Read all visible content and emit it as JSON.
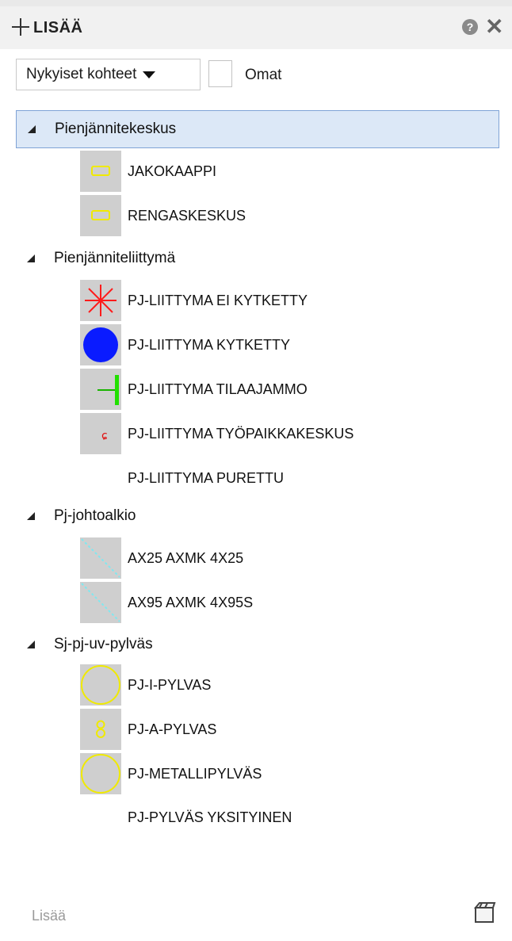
{
  "header": {
    "title": "LISÄÄ"
  },
  "filter": {
    "dropdown_value": "Nykyiset kohteet",
    "checkbox_label": "Omat"
  },
  "tree": [
    {
      "label": "Pienjännitekeskus",
      "selected": true,
      "items": [
        {
          "label": "JAKOKAAPPI",
          "icon": "yellow-rectangle-icon"
        },
        {
          "label": "RENGASKESKUS",
          "icon": "yellow-rectangle-icon"
        }
      ]
    },
    {
      "label": "Pienjänniteliittymä",
      "items": [
        {
          "label": "PJ-LIITTYMA EI KYTKETTY",
          "icon": "red-asterisk-icon"
        },
        {
          "label": "PJ-LIITTYMA KYTKETTY",
          "icon": "blue-circle-icon"
        },
        {
          "label": "PJ-LIITTYMA TILAAJAMMO",
          "icon": "green-tee-icon"
        },
        {
          "label": "PJ-LIITTYMA TYÖPAIKKAKESKUS",
          "icon": "red-mark-icon"
        },
        {
          "label": "PJ-LIITTYMA PURETTU",
          "icon": "none"
        }
      ]
    },
    {
      "label": "Pj-johtoalkio",
      "items": [
        {
          "label": "AX25 AXMK 4X25",
          "icon": "cyan-diagonal-icon"
        },
        {
          "label": "AX95 AXMK 4X95S",
          "icon": "cyan-diagonal-icon"
        }
      ]
    },
    {
      "label": "Sj-pj-uv-pylväs",
      "items": [
        {
          "label": "PJ-I-PYLVAS",
          "icon": "yellow-circle-icon"
        },
        {
          "label": "PJ-A-PYLVAS",
          "icon": "yellow-eight-icon"
        },
        {
          "label": "PJ-METALLIPYLVÄS",
          "icon": "yellow-circle-icon"
        },
        {
          "label": "PJ-PYLVÄS YKSITYINEN",
          "icon": "none"
        }
      ]
    }
  ],
  "footer": {
    "label": "Lisää",
    "icon": "clapperboard-icon"
  },
  "colors": {
    "selection_bg": "#dce8f7",
    "selection_border": "#7fa3d6",
    "swatch_bg": "#cfcfcf"
  }
}
